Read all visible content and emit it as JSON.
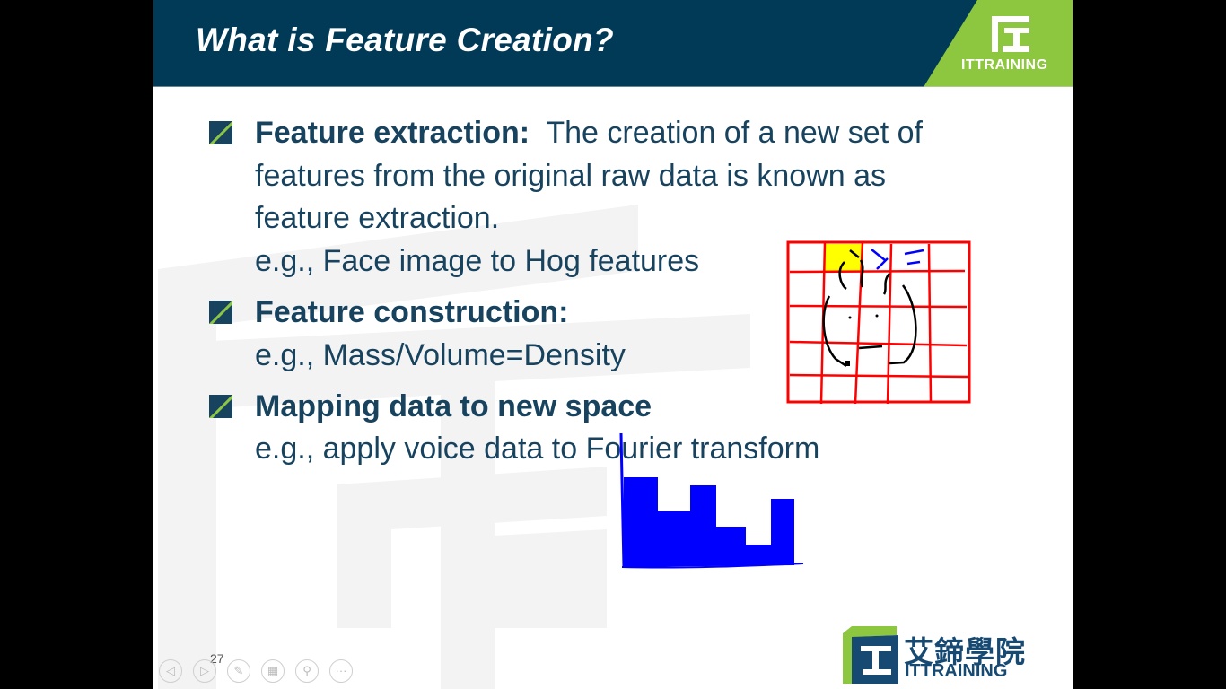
{
  "slide": {
    "title": "What is Feature Creation?",
    "header_logo_text": "ITTRAINING",
    "slide_number": "27",
    "bullets": [
      {
        "heading": "Feature extraction:",
        "text_line1": "  The creation of a new set of",
        "text_line2": "features from the original raw data is known as",
        "text_line3": "feature extraction.",
        "example": "e.g., Face image to Hog features"
      },
      {
        "heading": "Feature construction:",
        "example": "e.g., Mass/Volume=Density"
      },
      {
        "heading": "Mapping data to new space",
        "example": "e.g., apply voice data to Fourier transform"
      }
    ],
    "brand": {
      "chinese": "艾鍗學院",
      "english": "ITTRAINING"
    }
  },
  "nav": {
    "prev_icon": "arrow-left-icon",
    "next_icon": "arrow-right-icon",
    "pen_icon": "pen-icon",
    "slides_icon": "slides-grid-icon",
    "zoom_icon": "magnifier-icon",
    "more_icon": "more-options-icon"
  },
  "colors": {
    "header": "#003a57",
    "accent_green": "#8dc63f",
    "text": "#18435f",
    "ink_red": "#ff0000",
    "ink_blue": "#0000ff",
    "ink_yellow": "#ffff00"
  }
}
